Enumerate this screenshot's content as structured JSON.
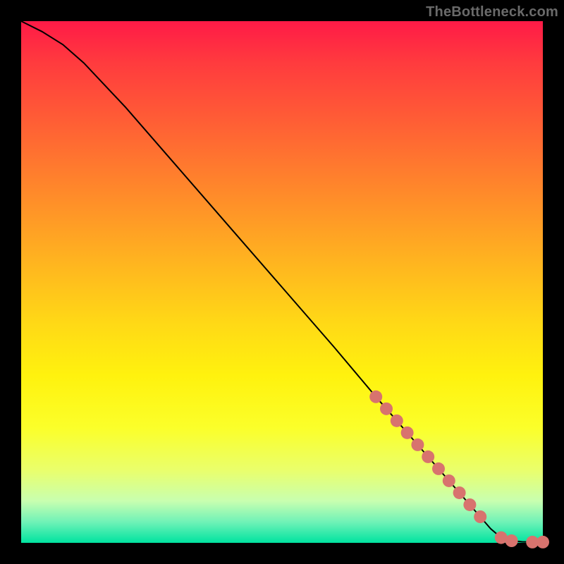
{
  "watermark": "TheBottleneck.com",
  "colors": {
    "dot": "#d8736e",
    "line": "#000000"
  },
  "chart_data": {
    "type": "line",
    "title": "",
    "xlabel": "",
    "ylabel": "",
    "xlim": [
      0,
      100
    ],
    "ylim": [
      0,
      100
    ],
    "grid": false,
    "notes": "No numeric tick labels are visible; x and y are expressed as 0–100 percentage of the plot area width/height, read from the rendered curve geometry. y=100 is the top, y=0 is the bottom.",
    "series": [
      {
        "name": "curve",
        "style": "solid",
        "x": [
          0,
          4,
          8,
          12,
          20,
          30,
          40,
          50,
          60,
          68,
          70,
          72,
          74,
          76,
          78,
          80,
          82,
          84,
          86,
          88,
          90,
          92,
          94,
          96,
          98,
          100
        ],
        "y": [
          100,
          98,
          95.5,
          92,
          83.5,
          72,
          60.5,
          49,
          37.5,
          28,
          25.7,
          23.4,
          21.1,
          18.8,
          16.5,
          14.2,
          11.9,
          9.6,
          7.3,
          5,
          2.7,
          1,
          0.4,
          0.2,
          0.15,
          0.15
        ]
      },
      {
        "name": "highlight-points",
        "style": "markers",
        "x": [
          68,
          70,
          72,
          74,
          76,
          78,
          80,
          82,
          84,
          86,
          88,
          92,
          94,
          98,
          100
        ],
        "y": [
          28,
          25.7,
          23.4,
          21.1,
          18.8,
          16.5,
          14.2,
          11.9,
          9.6,
          7.3,
          5,
          1,
          0.4,
          0.15,
          0.15
        ]
      }
    ]
  }
}
